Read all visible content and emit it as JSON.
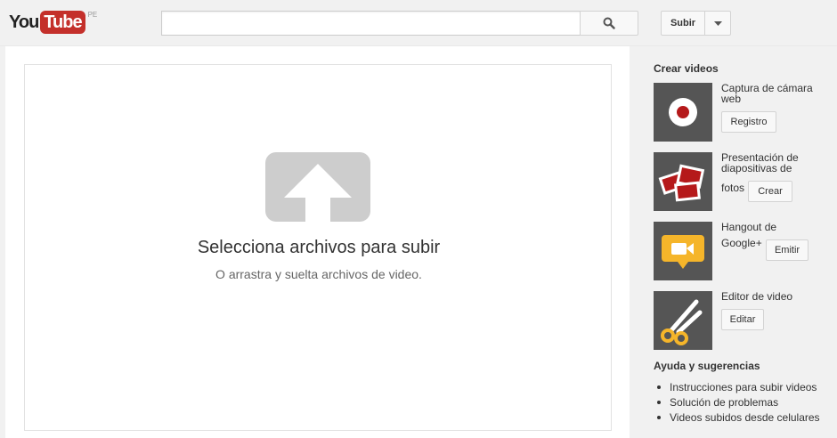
{
  "masthead": {
    "logo_you": "You",
    "logo_tube": "Tube",
    "logo_country": "PE",
    "search_placeholder": "",
    "search_icon": "search-icon",
    "upload_label": "Subir",
    "upload_menu_icon": "chevron-down-icon"
  },
  "dropzone": {
    "icon": "upload-arrow-icon",
    "title": "Selecciona archivos para subir",
    "subtitle": "O arrastra y suelta archivos de video."
  },
  "sidebar": {
    "create_heading": "Crear videos",
    "create_items": [
      {
        "label": "Captura de cámara web",
        "button": "Registro",
        "icon": "webcam-record-icon"
      },
      {
        "label": "Presentación de diapositivas de fotos",
        "label_line1": "Presentación de",
        "label_line2": "diapositivas de",
        "label_line3": "fotos",
        "button": "Crear",
        "icon": "photo-slideshow-icon"
      },
      {
        "label": "Hangout de Google+",
        "label_line1": "Hangout de",
        "label_line2": "Google+",
        "button": "Emitir",
        "icon": "hangout-camera-icon"
      },
      {
        "label": "Editor de video",
        "button": "Editar",
        "icon": "scissors-icon"
      }
    ],
    "help_heading": "Ayuda y sugerencias",
    "help_links": [
      "Instrucciones para subir videos",
      "Solución de problemas",
      "Videos subidos desde celulares"
    ]
  },
  "colors": {
    "brand_red": "#c4302b",
    "thumb_bg": "#555555",
    "hangout_yellow": "#f5b52a"
  }
}
